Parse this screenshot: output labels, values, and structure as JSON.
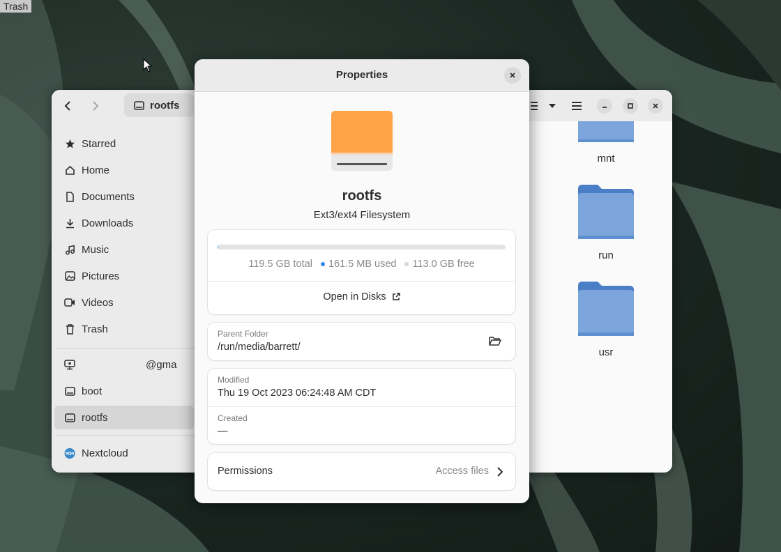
{
  "desktop": {
    "trash_label": "Trash"
  },
  "files_window": {
    "path_label": "rootfs",
    "sidebar": {
      "places": [
        {
          "label": "Starred",
          "icon": "star-icon"
        },
        {
          "label": "Home",
          "icon": "home-icon"
        },
        {
          "label": "Documents",
          "icon": "document-icon"
        },
        {
          "label": "Downloads",
          "icon": "download-icon"
        },
        {
          "label": "Music",
          "icon": "music-icon"
        },
        {
          "label": "Pictures",
          "icon": "picture-icon"
        },
        {
          "label": "Videos",
          "icon": "video-icon"
        },
        {
          "label": "Trash",
          "icon": "trash-icon"
        }
      ],
      "devices": [
        {
          "label": "@gma",
          "icon": "network-icon"
        },
        {
          "label": "boot",
          "icon": "drive-icon"
        },
        {
          "label": "rootfs",
          "icon": "drive-icon",
          "active": true
        }
      ],
      "other": [
        {
          "label": "Nextcloud",
          "icon": "nextcloud-icon"
        }
      ]
    },
    "folders": [
      "mnt",
      "run",
      "usr"
    ]
  },
  "properties": {
    "title": "Properties",
    "volume_name": "rootfs",
    "volume_type": "Ext3/ext4 Filesystem",
    "usage": {
      "total": "119.5 GB total",
      "used": "161.5 MB used",
      "free": "113.0 GB free",
      "used_fraction": 0.0014
    },
    "open_in_disks": "Open in Disks",
    "parent_folder": {
      "label": "Parent Folder",
      "value": "/run/media/barrett/"
    },
    "modified": {
      "label": "Modified",
      "value": "Thu 19 Oct 2023 06:24:48 AM CDT"
    },
    "created": {
      "label": "Created",
      "value": "—"
    },
    "permissions": {
      "label": "Permissions",
      "value": "Access files"
    }
  },
  "colors": {
    "accent": "#3584e4",
    "folder_blue": "#5e8fd0",
    "drive_orange": "#ffa348"
  }
}
